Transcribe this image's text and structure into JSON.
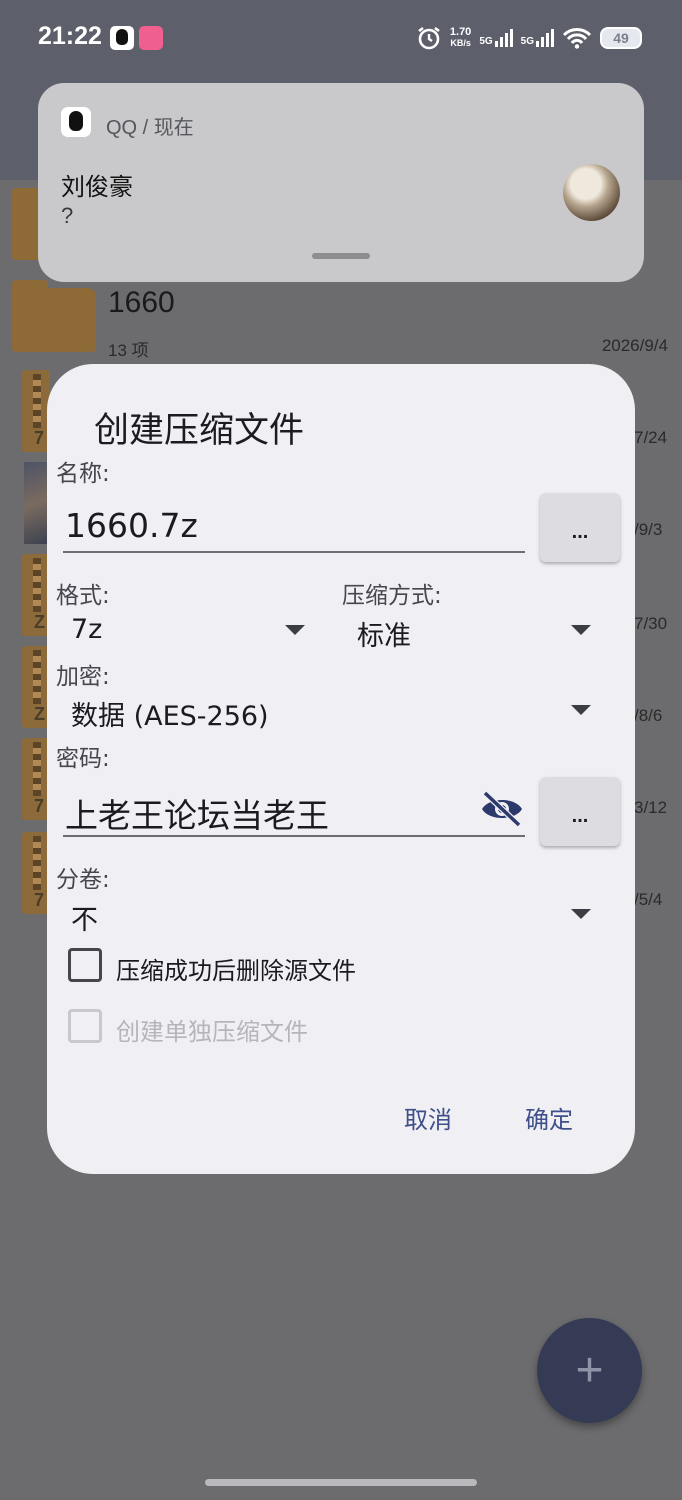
{
  "status_bar": {
    "time": "21:22",
    "net_speed_value": "1.70",
    "net_speed_unit": "KB/s",
    "sim1": "5G",
    "sim2": "5G",
    "battery": "49"
  },
  "notification": {
    "app_line": "QQ / 现在",
    "sender": "刘俊豪",
    "message": "?"
  },
  "file_list": {
    "folder_1660": {
      "name": "1660",
      "meta": "13 项",
      "date": "2026/9/4"
    },
    "partial_dates": [
      "7/24",
      "/9/3",
      "7/30",
      "/8/6",
      "3/12",
      "/5/4"
    ],
    "archive_letters": [
      "7",
      "Z",
      "Z",
      "7",
      "7"
    ]
  },
  "dialog": {
    "title": "创建压缩文件",
    "name_label": "名称:",
    "name_value": "1660.7z",
    "more_label": "...",
    "format_label": "格式:",
    "format_value": "7z",
    "compression_label": "压缩方式:",
    "compression_value": "标准",
    "encryption_label": "加密:",
    "encryption_value": "数据 (AES-256)",
    "password_label": "密码:",
    "password_value": "上老王论坛当老王",
    "split_label": "分卷:",
    "split_value": "不",
    "delete_source_label": "压缩成功后删除源文件",
    "delete_source_checked": false,
    "separate_archives_label": "创建单独压缩文件",
    "separate_archives_checked": false,
    "cancel_label": "取消",
    "ok_label": "确定"
  },
  "fab": {
    "icon": "plus-icon",
    "glyph": "+"
  },
  "colors": {
    "dialog_bg": "#f0eff4",
    "accent_text": "#3f4f8a",
    "fab_bg": "#353a55",
    "eye_icon": "#2b3a6b"
  }
}
